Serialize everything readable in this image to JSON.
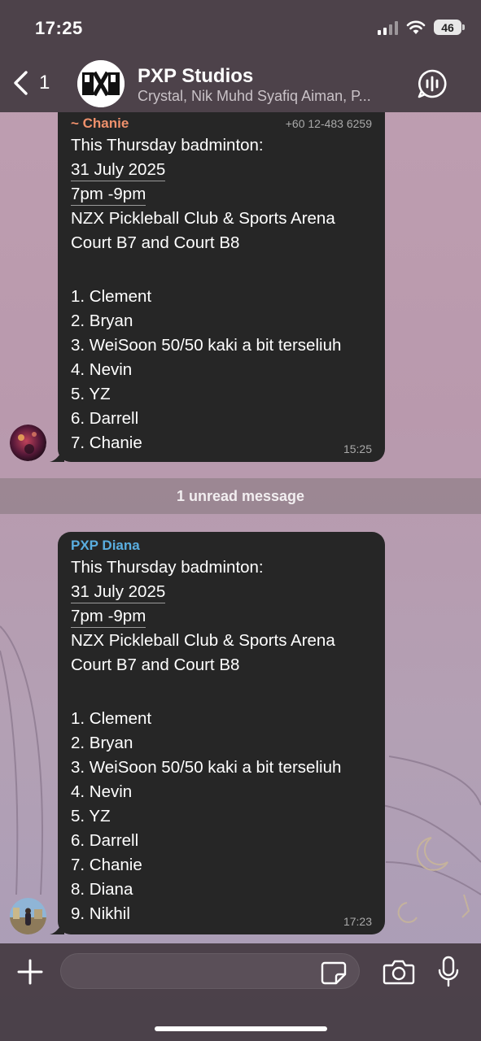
{
  "status_bar": {
    "time": "17:25",
    "battery": "46"
  },
  "header": {
    "back_count": "1",
    "avatar_text": "PXP",
    "title": "PXP Studios",
    "subtitle": "Crystal, Nik Muhd Syafiq Aiman, P..."
  },
  "messages": [
    {
      "sender": "~ Chanie",
      "sender_color": "#f0916c",
      "phone": "+60 12-483 6259",
      "lines": [
        "This Thursday badminton:",
        "31 July 2025",
        "7pm -9pm",
        "NZX Pickleball Club & Sports Arena",
        "Court B7 and Court B8",
        "1. Clement",
        "2. Bryan",
        "3. WeiSoon 50/50 kaki a bit terseliuh",
        "4. Nevin",
        "5. YZ",
        "6. Darrell",
        "7. Chanie"
      ],
      "time": "15:25"
    },
    {
      "sender": "PXP Diana",
      "sender_color": "#5aaee0",
      "lines": [
        "This Thursday badminton:",
        "31 July 2025",
        "7pm -9pm",
        "NZX Pickleball Club & Sports Arena",
        "Court B7 and Court B8",
        "1. Clement",
        "2. Bryan",
        "3. WeiSoon 50/50 kaki a bit terseliuh",
        "4. Nevin",
        "5. YZ",
        "6. Darrell",
        "7. Chanie",
        "8. Diana",
        "9. Nikhil"
      ],
      "time": "17:23"
    }
  ],
  "unread_label": "1 unread message",
  "composer": {
    "placeholder": ""
  },
  "colors": {
    "bubble": "#262626",
    "header": "#483e46",
    "accent_orange": "#f0916c",
    "accent_blue": "#5aaee0"
  },
  "icons": [
    "back-chevron-icon",
    "voice-chat-icon",
    "plus-icon",
    "sticker-icon",
    "camera-icon",
    "microphone-icon",
    "signal-icon",
    "wifi-icon",
    "battery-icon"
  ]
}
